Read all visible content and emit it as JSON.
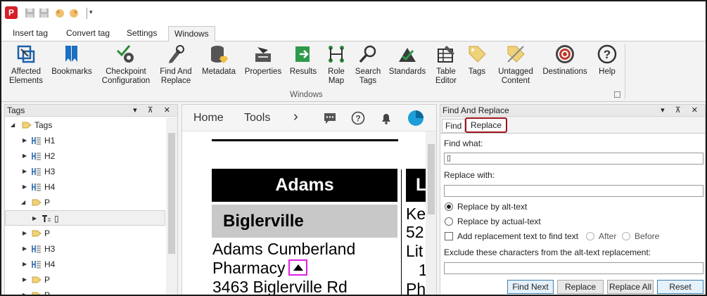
{
  "app": {
    "logo_glyph": "P"
  },
  "quick_access": {
    "dropdown_glyph": "▾"
  },
  "tabs": [
    {
      "label": "Insert tag"
    },
    {
      "label": "Convert tag"
    },
    {
      "label": "Settings"
    },
    {
      "label": "Windows",
      "active": true
    }
  ],
  "ribbon": {
    "group_label": "Windows",
    "buttons": [
      {
        "line1": "Affected",
        "line2": "Elements",
        "icon": "affected-elements-icon"
      },
      {
        "line1": "Bookmarks",
        "line2": "",
        "icon": "bookmark-icon"
      },
      {
        "line1": "Checkpoint",
        "line2": "Configuration",
        "icon": "checkpoint-gear-icon"
      },
      {
        "line1": "Find And",
        "line2": "Replace",
        "icon": "find-replace-icon"
      },
      {
        "line1": "Metadata",
        "line2": "",
        "icon": "database-icon"
      },
      {
        "line1": "Properties",
        "line2": "",
        "icon": "properties-icon"
      },
      {
        "line1": "Results",
        "line2": "",
        "icon": "results-icon"
      },
      {
        "line1": "Role",
        "line2": "Map",
        "icon": "role-map-icon"
      },
      {
        "line1": "Search",
        "line2": "Tags",
        "icon": "search-icon"
      },
      {
        "line1": "Standards",
        "line2": "",
        "icon": "standards-icon"
      },
      {
        "line1": "Table",
        "line2": "Editor",
        "icon": "table-editor-icon"
      },
      {
        "line1": "Tags",
        "line2": "",
        "icon": "tag-icon"
      },
      {
        "line1": "Untagged",
        "line2": "Content",
        "icon": "untagged-icon"
      },
      {
        "line1": "Destinations",
        "line2": "",
        "icon": "target-icon"
      },
      {
        "line1": "Help",
        "line2": "",
        "icon": "help-icon"
      }
    ]
  },
  "tags_panel": {
    "title": "Tags",
    "controls": "▾ ⊼ ✕",
    "items": [
      {
        "label": "Tags",
        "level": 0,
        "expanded": true
      },
      {
        "label": "H1",
        "level": 1
      },
      {
        "label": "H2",
        "level": 1
      },
      {
        "label": "H3",
        "level": 1
      },
      {
        "label": "H4",
        "level": 1
      },
      {
        "label": "P",
        "level": 1,
        "expanded": true
      },
      {
        "label": "▯",
        "level": 2,
        "selected": true
      },
      {
        "label": "P",
        "level": 1
      },
      {
        "label": "H3",
        "level": 1
      },
      {
        "label": "H4",
        "level": 1
      },
      {
        "label": "P",
        "level": 1
      },
      {
        "label": "P",
        "level": 1
      }
    ]
  },
  "document": {
    "toolbar": {
      "home": "Home",
      "tools": "Tools",
      "chevron": "›"
    },
    "content": {
      "header_text": "Adams",
      "subheader_text": "Biglerville",
      "line1": "Adams Cumberland",
      "line2": "Pharmacy",
      "line3": "3463 Biglerville Rd",
      "col2_header": "L",
      "col2_line1": "Ke",
      "col2_line2": "52",
      "col2_line3": "Lit",
      "col2_line4": "1",
      "col2_line5": "Ph"
    }
  },
  "find_replace": {
    "title": "Find And Replace",
    "controls": "▾ ⊼ ✕",
    "tab_find": "Find",
    "tab_replace": "Replace",
    "find_what_label": "Find what:",
    "find_what_value": "▯",
    "replace_with_label": "Replace with:",
    "replace_with_value": "",
    "opt_alt": "Replace by alt-text",
    "opt_actual": "Replace by actual-text",
    "opt_add": "Add replacement text to find text",
    "opt_after": "After",
    "opt_before": "Before",
    "exclude_label": "Exclude these characters from the alt-text replacement:",
    "exclude_value": "",
    "btn_find_next": "Find Next",
    "btn_replace": "Replace",
    "btn_replace_all": "Replace All",
    "btn_reset": "Reset"
  },
  "colors": {
    "accent_red": "#a0141e",
    "tag_marker": "#e020e0",
    "primary_button": "#3c7fb1"
  }
}
